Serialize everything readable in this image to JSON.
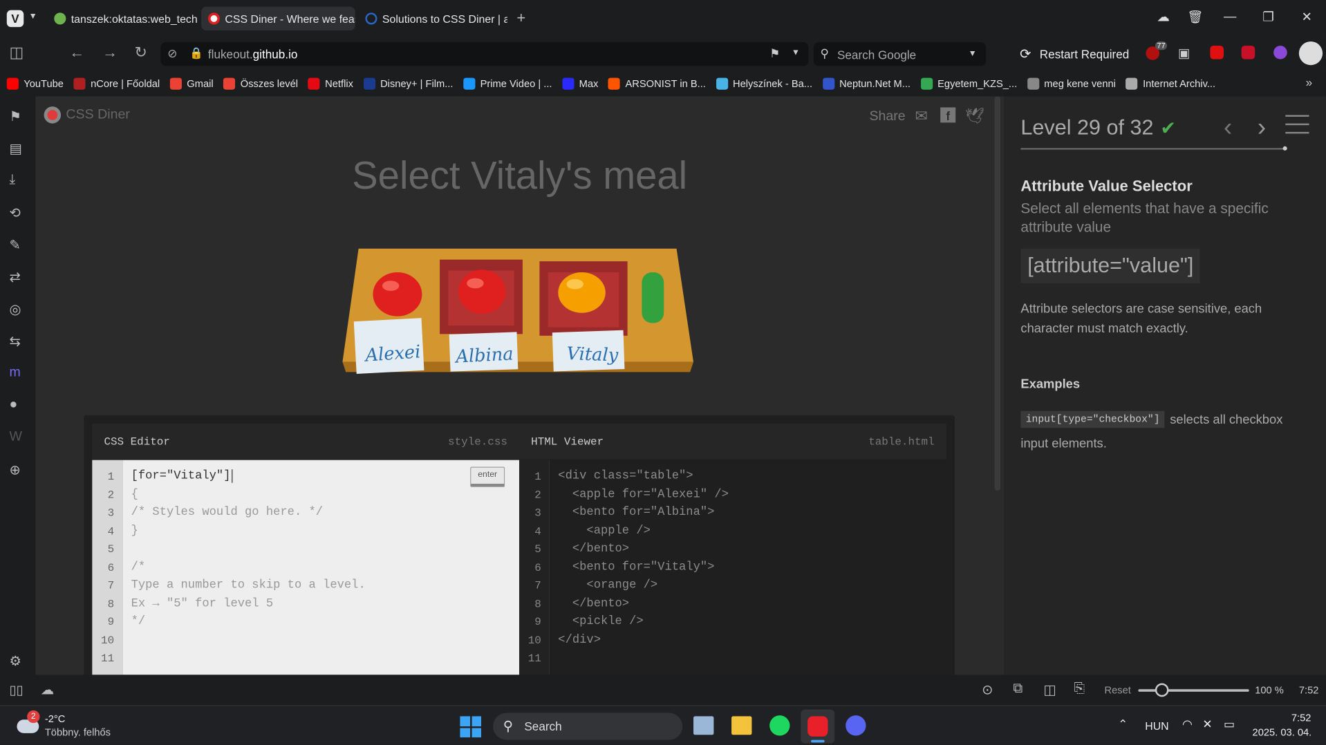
{
  "browser": {
    "tabs": [
      {
        "title": "tanszek:oktatas:web_techno"
      },
      {
        "title": "CSS Diner - Where we feast"
      },
      {
        "title": "Solutions to CSS Diner | anc"
      }
    ],
    "url_prefix": "flukeout.",
    "url_domain": "github.io",
    "search_placeholder": "Search Google",
    "restart_label": "Restart Required",
    "extension_badge": "77",
    "bookmarks": [
      {
        "label": "YouTube",
        "color": "#ff0000"
      },
      {
        "label": "nCore | Főoldal",
        "color": "#b02020"
      },
      {
        "label": "Gmail",
        "color": "#ea4335"
      },
      {
        "label": "Összes levél",
        "color": "#ea4335"
      },
      {
        "label": "Netflix",
        "color": "#e50914"
      },
      {
        "label": "Disney+ | Film...",
        "color": "#1a3b8f"
      },
      {
        "label": "Prime Video | ...",
        "color": "#1a98ff"
      },
      {
        "label": "Max",
        "color": "#2a2aff"
      },
      {
        "label": "ARSONIST in B...",
        "color": "#ff5500"
      },
      {
        "label": "Helyszínek - Ba...",
        "color": "#49b3e8"
      },
      {
        "label": "Neptun.Net M...",
        "color": "#3355cc"
      },
      {
        "label": "Egyetem_KZS_...",
        "color": "#34a853"
      },
      {
        "label": "meg kene venni",
        "color": "#888888"
      },
      {
        "label": "Internet Archiv...",
        "color": "#aaaaaa"
      }
    ]
  },
  "game": {
    "logo": "CSS Diner",
    "share_label": "Share",
    "heading": "Select Vitaly's meal",
    "nametags": [
      "Alexei",
      "Albina",
      "Vitaly"
    ],
    "css_editor": {
      "title": "CSS Editor",
      "file": "style.css",
      "enter_label": "enter",
      "input_value": "[for=\"Vitaly\"]",
      "lines": [
        "{",
        "/* Styles would go here. */",
        "}",
        "",
        "/*",
        "Type a number to skip to a level.",
        "Ex → \"5\" for level 5",
        "*/",
        "",
        ""
      ],
      "line_numbers": [
        "1",
        "2",
        "3",
        "4",
        "5",
        "6",
        "7",
        "8",
        "9",
        "10",
        "11"
      ]
    },
    "html_viewer": {
      "title": "HTML Viewer",
      "file": "table.html",
      "lines": [
        "<div class=\"table\">",
        "  <apple for=\"Alexei\" />",
        "  <bento for=\"Albina\">",
        "    <apple />",
        "  </bento>",
        "  <bento for=\"Vitaly\">",
        "    <orange />",
        "  </bento>",
        "  <pickle />",
        "</div>",
        ""
      ],
      "line_numbers": [
        "1",
        "2",
        "3",
        "4",
        "5",
        "6",
        "7",
        "8",
        "9",
        "10",
        "11"
      ]
    }
  },
  "sidebar": {
    "level": "Level 29 of 32",
    "title": "Attribute Value Selector",
    "subtitle": "Select all elements that have a specific attribute value",
    "syntax": "[attribute=\"value\"]",
    "hint": "Attribute selectors are case sensitive, each character must match exactly.",
    "examples_label": "Examples",
    "example_code": "input[type=\"checkbox\"]",
    "example_text1": "selects all checkbox",
    "example_text2": "input elements."
  },
  "statusbar": {
    "reset": "Reset",
    "zoom": "100 %",
    "time": "7:52"
  },
  "taskbar": {
    "weather_badge": "2",
    "temperature": "-2°C",
    "weather_desc": "Többny. felhős",
    "search": "Search",
    "lang": "HUN",
    "time": "7:52",
    "date": "2025. 03. 04."
  },
  "colors": {
    "accent_green": "#4caf50",
    "apple": "#e0201e",
    "orange": "#f5a000",
    "pickle": "#33a13d",
    "table": "#d4962e"
  }
}
